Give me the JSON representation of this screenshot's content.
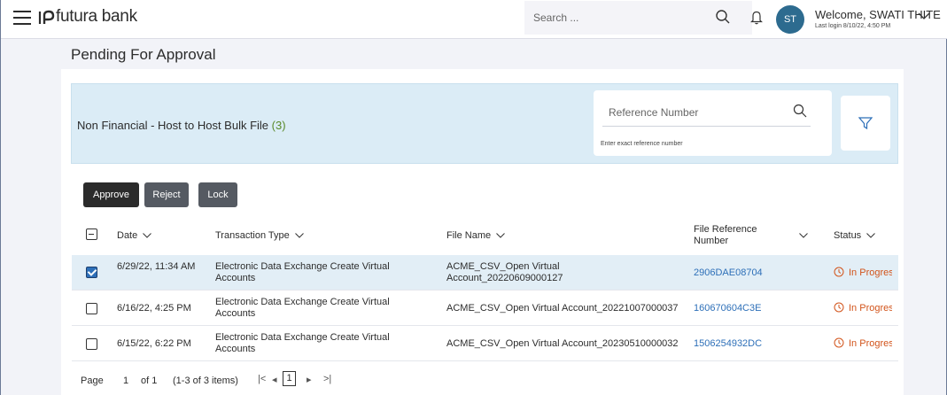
{
  "header": {
    "brand": "futura bank",
    "search_placeholder": "Search ...",
    "avatar_initials": "ST",
    "welcome": "Welcome, SWATI THITE",
    "last_login": "Last login 8/10/22, 4:50 PM"
  },
  "page": {
    "title": "Pending For Approval"
  },
  "section": {
    "title": "Non Financial - Host to Host Bulk File",
    "count": "(3)",
    "reference_placeholder": "Reference Number",
    "reference_hint": "Enter exact reference number"
  },
  "actions": {
    "approve": "Approve",
    "reject": "Reject",
    "lock": "Lock"
  },
  "table": {
    "columns": {
      "date": "Date",
      "transaction_type": "Transaction Type",
      "file_name": "File Name",
      "file_reference": "File Reference Number",
      "status": "Status"
    },
    "rows": [
      {
        "selected": true,
        "date": "6/29/22, 11:34 AM",
        "transaction_type": "Electronic Data Exchange Create Virtual Accounts",
        "file_name": "ACME_CSV_Open Virtual Account_20220609000127",
        "file_reference": "2906DAE08704",
        "status": "In Progress"
      },
      {
        "selected": false,
        "date": "6/16/22, 4:25 PM",
        "transaction_type": "Electronic Data Exchange Create Virtual Accounts",
        "file_name": "ACME_CSV_Open Virtual Account_20221007000037",
        "file_reference": "160670604C3E",
        "status": "In Progress"
      },
      {
        "selected": false,
        "date": "6/15/22, 6:22 PM",
        "transaction_type": "Electronic Data Exchange Create Virtual Accounts",
        "file_name": "ACME_CSV_Open Virtual Account_20230510000032",
        "file_reference": "1506254932DC",
        "status": "In Progress"
      }
    ]
  },
  "pagination": {
    "page_label": "Page",
    "current_page": "1",
    "of_label": "of 1",
    "items_summary": "(1-3 of 3 items)",
    "first": "|<",
    "prev": "◂",
    "next": "▸",
    "last": ">|"
  },
  "colors": {
    "accent": "#2d6fb8",
    "status_in_progress": "#d2541b",
    "filter_band": "#dbecf6",
    "selected_row": "#e2eef6"
  }
}
